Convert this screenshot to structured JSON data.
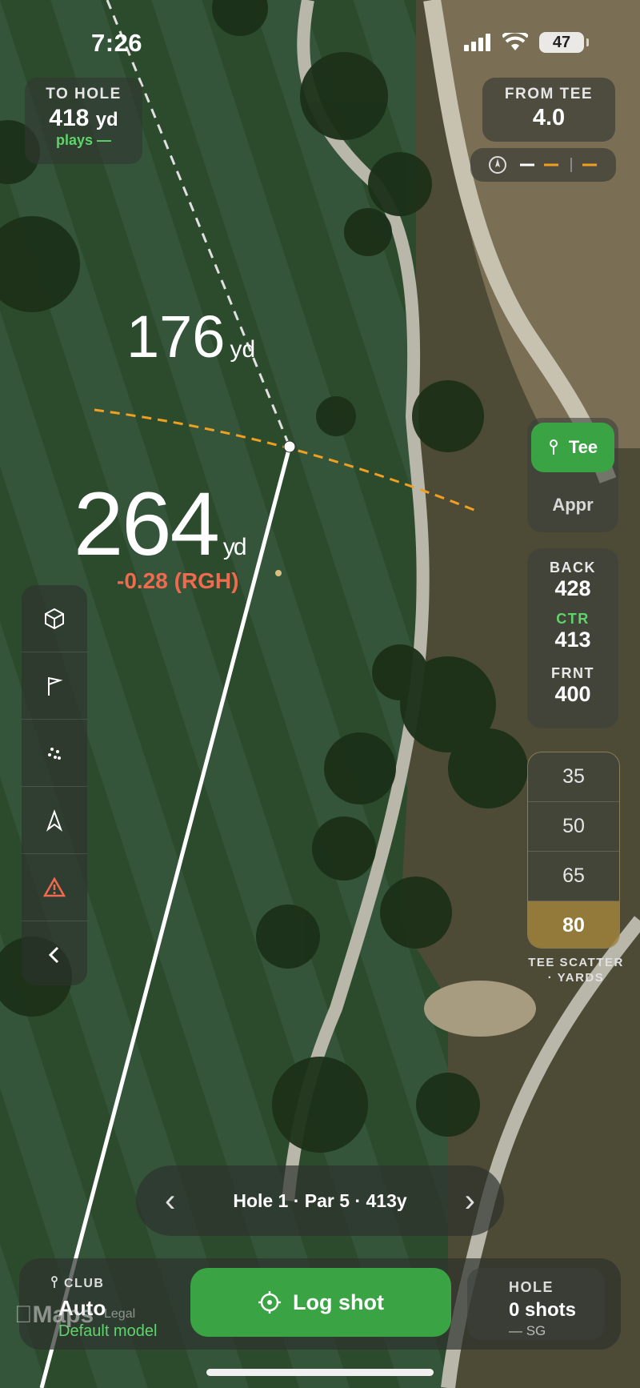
{
  "status": {
    "time": "7:26",
    "battery": "47"
  },
  "to_hole": {
    "label": "TO HOLE",
    "value": "418",
    "unit": "yd",
    "plays": "plays —"
  },
  "from_tee": {
    "label": "FROM TEE",
    "value": "4.0"
  },
  "map": {
    "dist_far": "176",
    "dist_far_unit": "yd",
    "dist_main": "264",
    "dist_main_unit": "yd",
    "strokes_gained": "-0.28 (RGH)",
    "line_color": "#ffffff",
    "arc_color": "#f0a020"
  },
  "tools": [
    "cube-icon",
    "flag-icon",
    "dots-icon",
    "navigation-icon",
    "warning-icon",
    "chevron-left-icon"
  ],
  "mode": {
    "tee": "Tee",
    "appr": "Appr"
  },
  "yardages": [
    {
      "label": "BACK",
      "value": "428"
    },
    {
      "label": "CTR",
      "value": "413"
    },
    {
      "label": "FRNT",
      "value": "400"
    }
  ],
  "scatter": {
    "options": [
      "35",
      "50",
      "65",
      "80"
    ],
    "selected": "80",
    "caption_1": "TEE SCATTER",
    "caption_2": "· YARDS"
  },
  "hole_nav": {
    "title": "Hole 1 · Par 5 · 413y"
  },
  "club": {
    "label": "CLUB",
    "value": "Auto",
    "model": "Default model"
  },
  "log_shot": {
    "label": "Log shot"
  },
  "hole": {
    "label": "HOLE",
    "value": "0 shots",
    "sg": "— SG"
  },
  "maps": {
    "brand": "Maps",
    "legal": "Legal"
  },
  "colors": {
    "accent_green": "#3aa344",
    "text_green": "#5fd46a",
    "sg_red": "#f06a4f",
    "scatter_gold": "#be963c"
  }
}
